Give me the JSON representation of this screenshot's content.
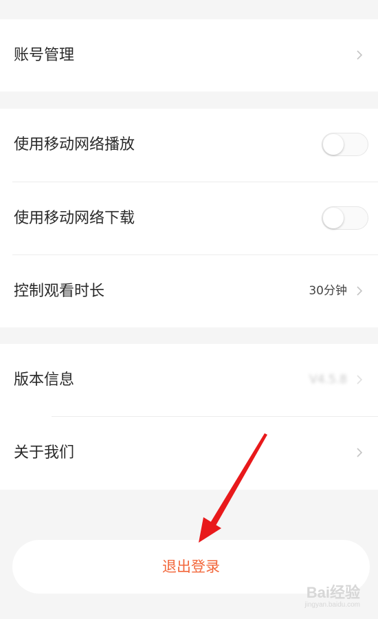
{
  "section1": {
    "account": {
      "label": "账号管理"
    }
  },
  "section2": {
    "mobile_play": {
      "label": "使用移动网络播放",
      "enabled": false
    },
    "mobile_download": {
      "label": "使用移动网络下载",
      "enabled": false
    },
    "watch_time": {
      "label": "控制观看时长",
      "value": "30分钟"
    }
  },
  "section3": {
    "version": {
      "label": "版本信息",
      "value": "V4.5.8"
    },
    "about": {
      "label": "关于我们"
    }
  },
  "logout": {
    "label": "退出登录"
  },
  "annotation": {
    "arrow_color": "#e8191b"
  },
  "watermark": {
    "main": "Bai经验",
    "sub": "jingyan.baidu.com"
  },
  "colors": {
    "accent": "#f2663a",
    "background": "#f5f5f5"
  }
}
